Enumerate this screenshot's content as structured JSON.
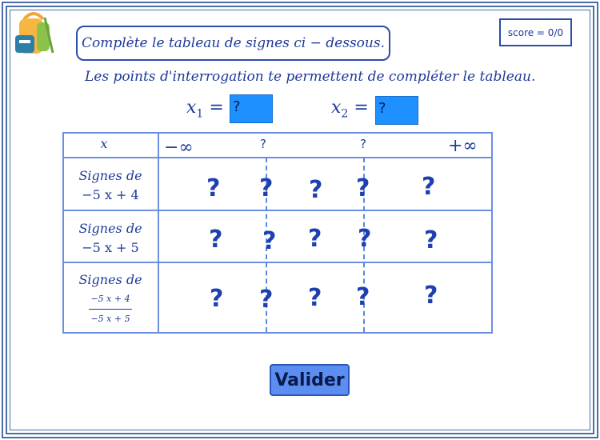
{
  "instruction": "Complète le tableau de signes ci − dessous.",
  "score": "score = 0/0",
  "hint": "Les points d'interrogation te permettent de compléter le tableau.",
  "x1": {
    "label": "x",
    "sub": "1",
    "eq": "=",
    "value": "?"
  },
  "x2": {
    "label": "x",
    "sub": "2",
    "eq": "=",
    "value": "?"
  },
  "table": {
    "header": {
      "var": "x",
      "minus_inf": "−∞",
      "root1": "?",
      "root2": "?",
      "plus_inf": "+∞"
    },
    "rows": [
      {
        "line1": "Signes de",
        "line2": "−5 x + 4"
      },
      {
        "line1": "Signes de",
        "line2": "−5 x + 5"
      },
      {
        "line1": "Signes de",
        "num": "−5 x + 4",
        "den": "−5 x + 5"
      }
    ],
    "q": "?"
  },
  "button": "Valider",
  "icons": {
    "logo": "backpack-icon"
  }
}
